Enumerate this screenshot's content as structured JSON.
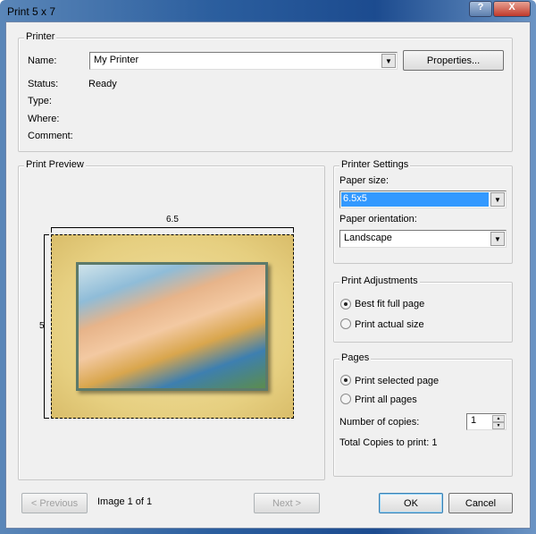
{
  "window": {
    "title": "Print 5 x 7",
    "help_icon": "?",
    "close_icon": "X"
  },
  "printer": {
    "legend": "Printer",
    "name_label": "Name:",
    "name_value": "My Printer",
    "properties_label": "Properties...",
    "status_label": "Status:",
    "status_value": "Ready",
    "type_label": "Type:",
    "where_label": "Where:",
    "comment_label": "Comment:"
  },
  "preview": {
    "legend": "Print Preview",
    "width_label": "6.5",
    "height_label": "5"
  },
  "settings": {
    "legend": "Printer Settings",
    "paper_size_label": "Paper size:",
    "paper_size_value": "6.5x5",
    "orientation_label": "Paper orientation:",
    "orientation_value": "Landscape"
  },
  "adjust": {
    "legend": "Print Adjustments",
    "best_fit": "Best fit full page",
    "actual": "Print actual size",
    "selected": "best_fit"
  },
  "pages": {
    "legend": "Pages",
    "selected_page": "Print selected page",
    "all_pages": "Print all pages",
    "copies_label": "Number of copies:",
    "copies_value": "1",
    "total_label": "Total Copies to print: 1"
  },
  "footer": {
    "previous": "< Previous",
    "image_counter": "Image 1 of 1",
    "next": "Next >",
    "ok": "OK",
    "cancel": "Cancel"
  }
}
